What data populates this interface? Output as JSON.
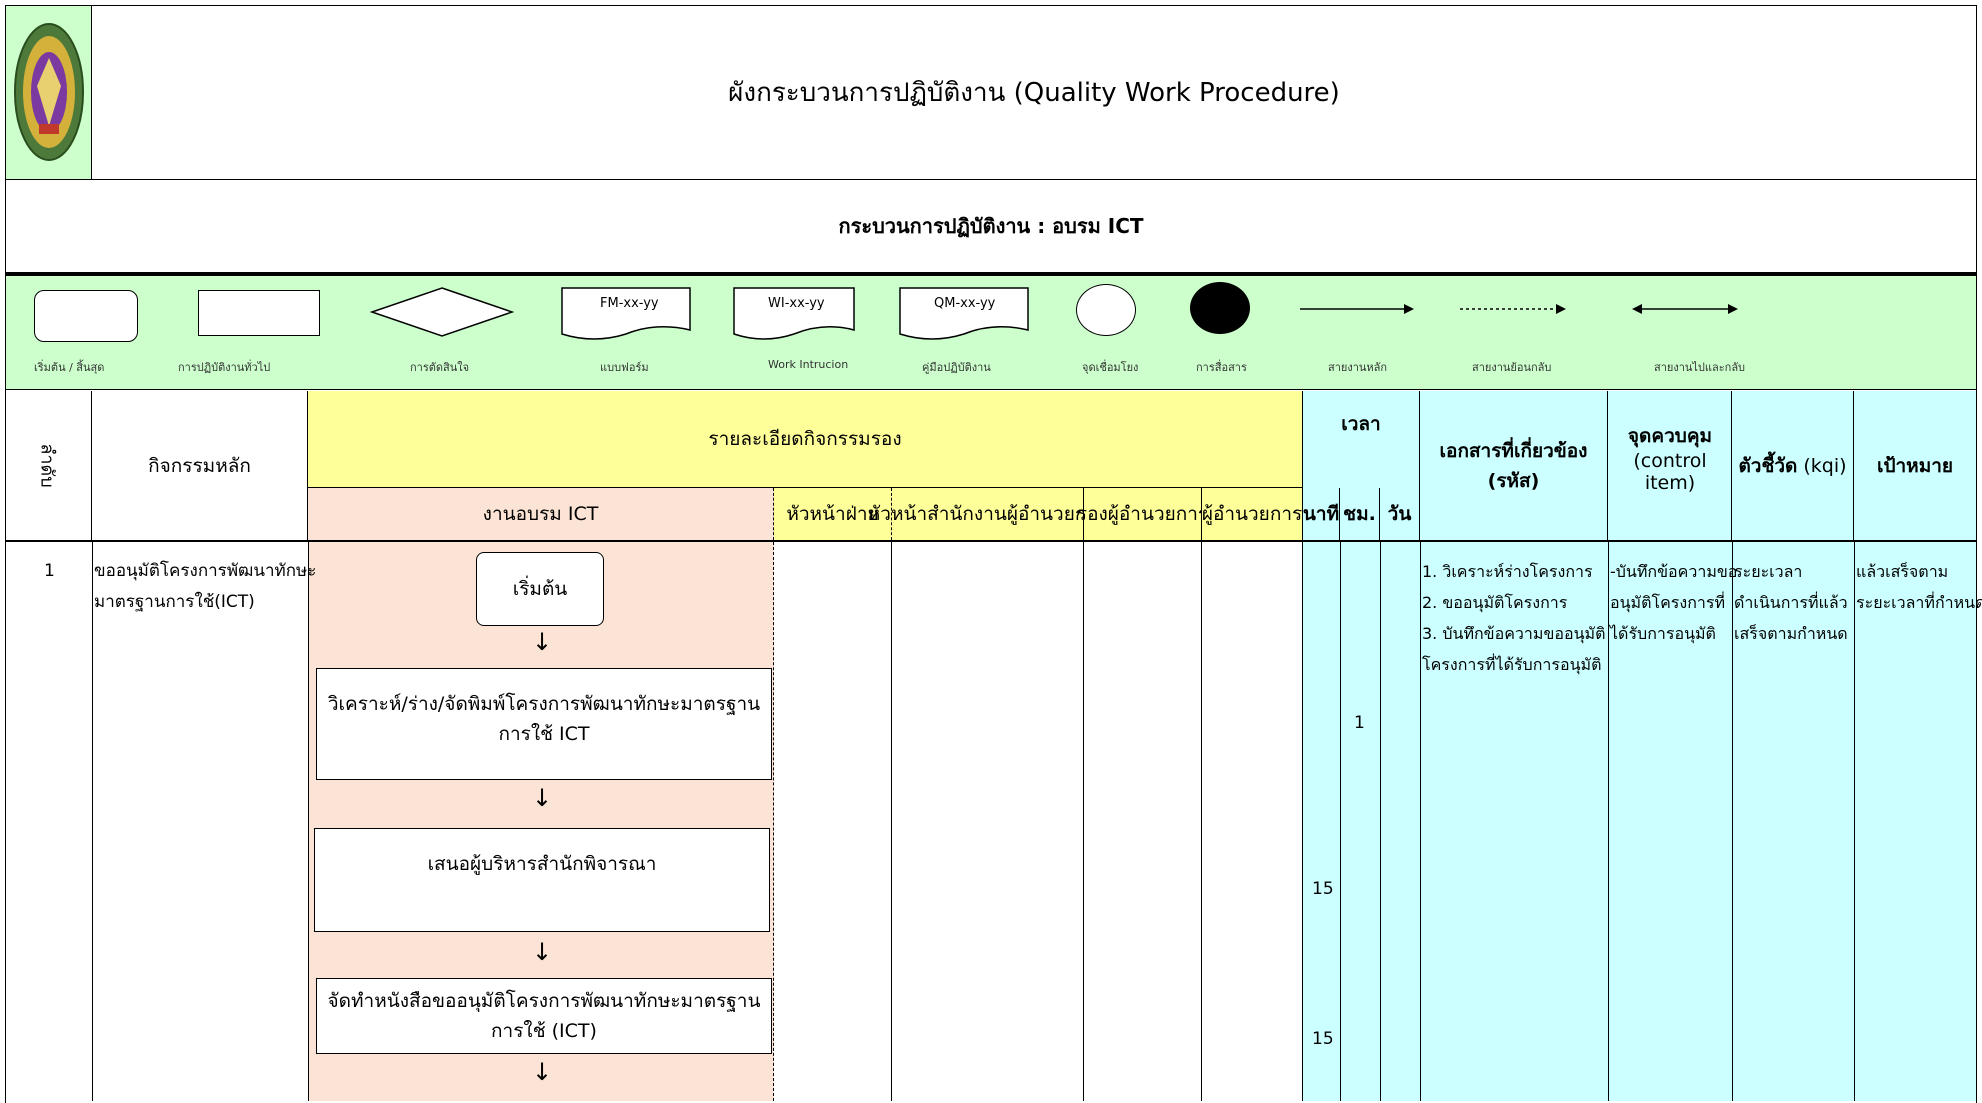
{
  "title": "ผังกระบวนการปฏิบัติงาน (Quality Work Procedure)",
  "process_label": "กระบวนการปฏิบัติงาน  : อบรม ICT",
  "legend": [
    {
      "caption": "เริ่มต้น / สิ้นสุด",
      "icon": "terminal-shape"
    },
    {
      "caption": "การปฏิบัติงานทั่วไป",
      "icon": "process-box"
    },
    {
      "caption": "การตัดสินใจ",
      "icon": "decision-diamond"
    },
    {
      "caption": "แบบฟอร์ม",
      "icon": "form-document",
      "code": "FM-xx-yy"
    },
    {
      "caption": "Work Intrucion",
      "icon": "work-instruction-document",
      "code": "WI-xx-yy"
    },
    {
      "caption": "คู่มือปฏิบัติงาน",
      "icon": "manual-document",
      "code": "QM-xx-yy"
    },
    {
      "caption": "จุดเชื่อมโยง",
      "icon": "connector-circle"
    },
    {
      "caption": "การสื่อสาร",
      "icon": "communication-dot"
    },
    {
      "caption": "สายงานหลัก",
      "icon": "solid-arrow"
    },
    {
      "caption": "สายงานย้อนกลับ",
      "icon": "dashed-arrow"
    },
    {
      "caption": "สายงานไปและกลับ",
      "icon": "double-arrow"
    }
  ],
  "header": {
    "step_no": "ลำดับ",
    "main_activity": "กิจกรรมหลัก",
    "sub_detail": "รายละเอียดกิจกรรมรอง",
    "lanes": [
      "งานอบรม ICT",
      "หัวหน้าฝ่าย",
      "หัวหน้าสำนักงานผู้อำนวยการ",
      "รองผู้อำนวยการ",
      "ผู้อำนวยการ"
    ],
    "time": "เวลา",
    "time_units": [
      "นาที",
      "ชม.",
      "วัน"
    ],
    "documents": "เอกสารที่เกี่ยวข้อง (รหัส)",
    "control_point": "จุดควบคุม",
    "control_item": "(control item)",
    "kpi": "ตัวชี้วัด",
    "kpi_unit": "(kqi)",
    "target": "เป้าหมาย"
  },
  "row": {
    "no": "1",
    "main_activity": [
      "ขออนุมัติโครงการพัฒนาทักษะ",
      "มาตรฐานการใช้(ICT)"
    ],
    "flow": {
      "start": "เริ่มต้น",
      "step1": "วิเคราะห์/ร่าง/จัดพิมพ์โครงการพัฒนาทักษะมาตรฐานการใช้  ICT",
      "step2": "เสนอผู้บริหารสำนักพิจารณา",
      "step3": "จัดทำหนังสือขออนุมัติโครงการพัฒนาทักษะมาตรฐานการใช้  (ICT)"
    },
    "time_min": [
      "15",
      "15"
    ],
    "time_hr": "1",
    "documents": [
      "1. วิเคราะห์ร่างโครงการ",
      "2. ขออนุมัติโครงการ",
      "3. บันทึกข้อความขออนุมัติ",
      "โครงการที่ได้รับการอนุมัติ"
    ],
    "control": [
      "-บันทึกข้อความขอ",
      "อนุมัติโครงการที่",
      "ได้รับการอนุมัติ"
    ],
    "kpi": [
      "ระยะเวลา",
      "ดำเนินการที่แล้ว",
      "เสร็จตามกำหนด"
    ],
    "target": [
      "แล้วเสร็จตาม",
      "ระยะเวลาที่กำหนด"
    ]
  },
  "colors": {
    "green": "#CCFFCC",
    "yellow": "#FFFF99",
    "peach": "#FBE4D5",
    "cyan": "#CCFFFF"
  }
}
